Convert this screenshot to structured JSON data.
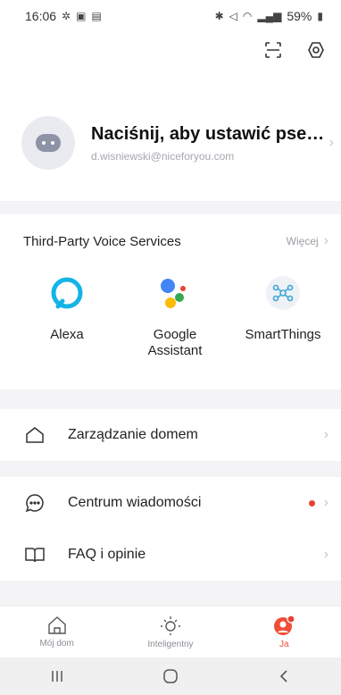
{
  "status": {
    "time": "16:06",
    "battery": "59%"
  },
  "profile": {
    "name": "Naciśnij, aby ustawić pse…",
    "email": "d.wisniewski@niceforyou.com"
  },
  "voice": {
    "title": "Third-Party Voice Services",
    "more": "Więcej",
    "services": [
      {
        "label": "Alexa",
        "icon": "alexa-icon"
      },
      {
        "label": "Google\nAssistant",
        "icon": "google-assistant-icon"
      },
      {
        "label": "SmartThings",
        "icon": "smartthings-icon"
      }
    ]
  },
  "menu": {
    "home": "Zarządzanie domem",
    "messages": "Centrum wiadomości",
    "faq": "FAQ i opinie"
  },
  "tabs": {
    "home": "Mój dom",
    "smart": "Inteligentny",
    "me": "Ja"
  },
  "colors": {
    "accent": "#ef4f36",
    "alexa": "#14b4e6",
    "badge": "#e54335"
  }
}
